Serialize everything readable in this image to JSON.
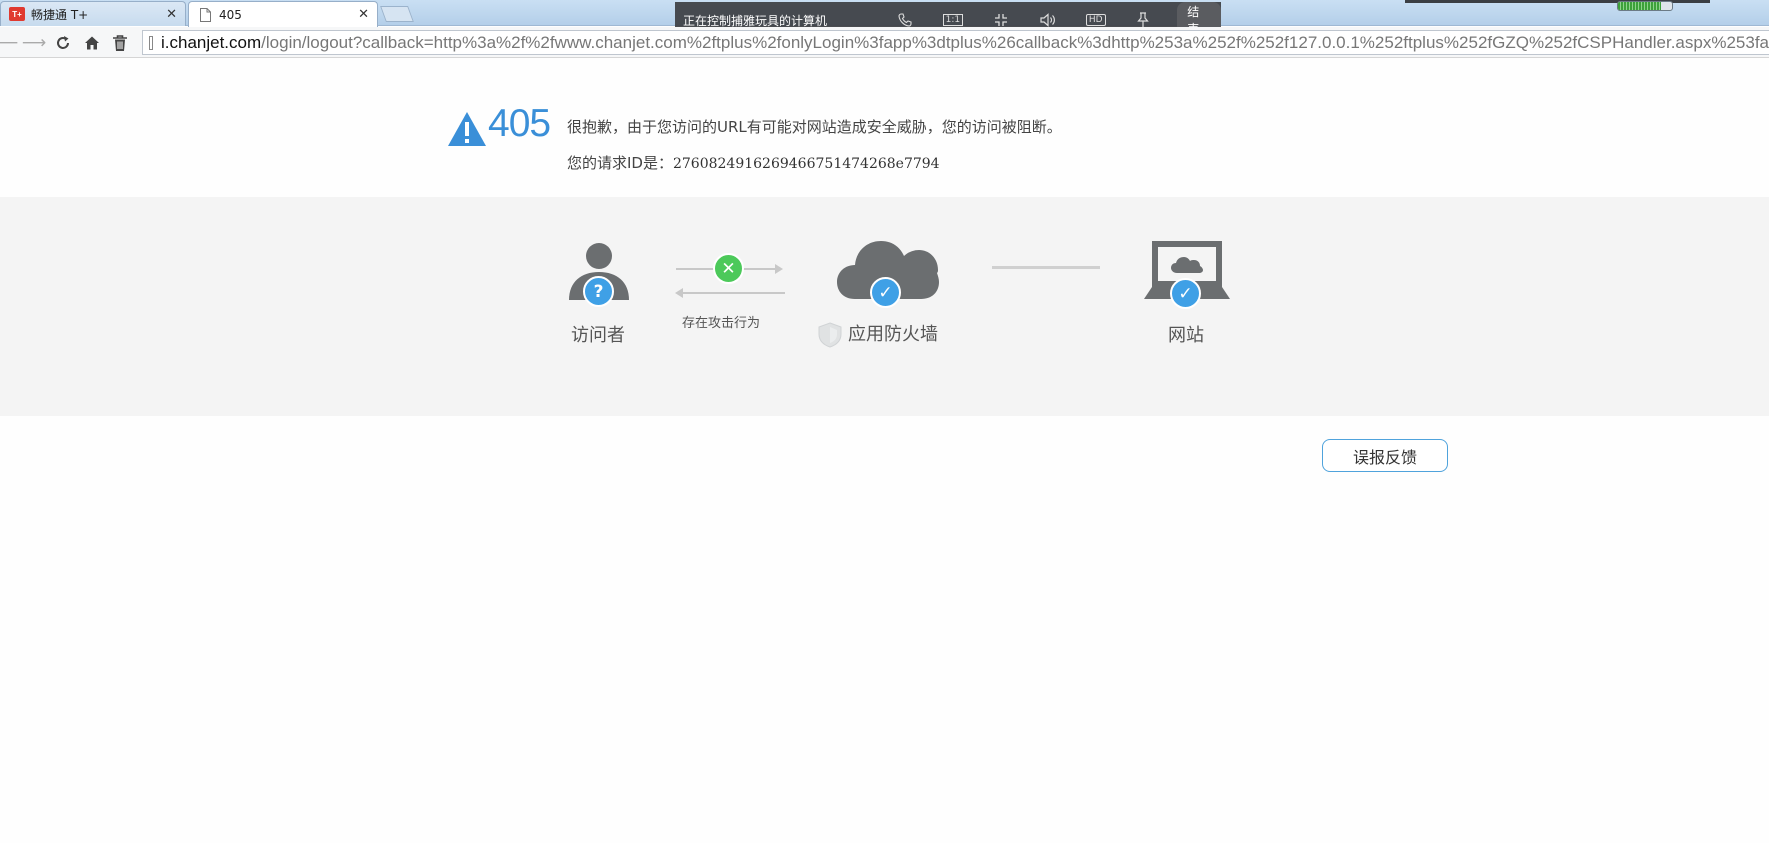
{
  "browser": {
    "tabs": [
      {
        "label": "畅捷通 T+",
        "favicon": "T+",
        "active": false
      },
      {
        "label": "405",
        "active": true
      }
    ],
    "address": {
      "host": "i.chanjet.com",
      "path": "/login/logout?callback=http%3a%2f%2fwww.chanjet.com%2ftplus%2fonlyLogin%3fapp%3dtplus%26callback%3dhttp%253a%252f%252f127.0.0.1%252ftplus%252fGZQ%252fCSPHandler.aspx%253fa"
    }
  },
  "remote_control": {
    "title": "正在控制捕雅玩具的计算机",
    "ratio_label": "1:1",
    "hd_label": "HD",
    "end_label": "结束"
  },
  "error": {
    "code": "405",
    "message": "很抱歉，由于您访问的URL有可能对网站造成安全威胁，您的访问被阻断。",
    "request_id_label": "您的请求ID是：",
    "request_id": "2760824916269466751474268e7794"
  },
  "diagram": {
    "visitor_label": "访问者",
    "attack_label": "存在攻击行为",
    "firewall_label": "应用防火墙",
    "website_label": "网站"
  },
  "feedback": {
    "label": "误报反馈"
  },
  "colors": {
    "accent_blue": "#3a8fd8",
    "badge_blue": "#3fa0e6",
    "block_green": "#4cc95a",
    "icon_gray": "#6b6e70"
  }
}
